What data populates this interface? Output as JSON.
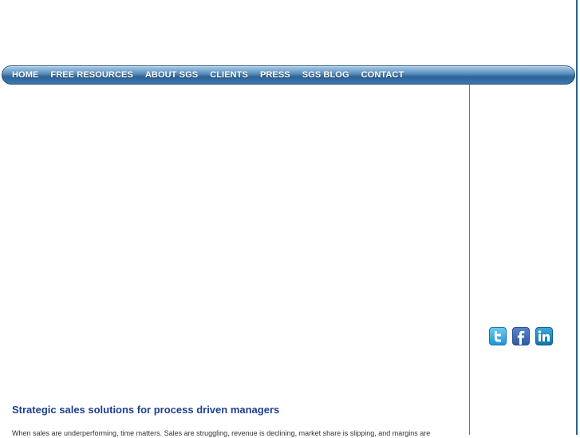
{
  "nav": {
    "items": [
      "HOME",
      "FREE RESOURCES",
      "ABOUT SGS",
      "CLIENTS",
      "PRESS",
      "SGS BLOG",
      "CONTACT"
    ]
  },
  "social": [
    "twitter-icon",
    "facebook-icon",
    "linkedin-icon"
  ],
  "main": {
    "headline": "Strategic sales solutions for process driven managers",
    "intro": "When sales are underperforming, time matters. Sales are struggling, revenue is declining, market share is slipping, and margins are"
  },
  "colors": {
    "nav_bar": "#3d77ab",
    "headline": "#1f3f8f",
    "divider": "#4f7fae"
  }
}
